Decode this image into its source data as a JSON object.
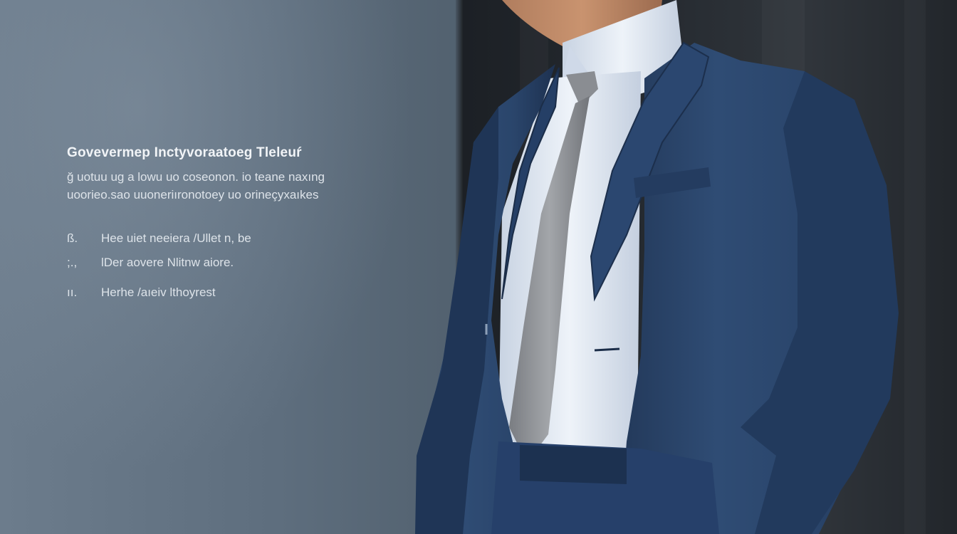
{
  "overlay": {
    "headline": "Govevermep Inctyvoraatoeg Tleleuŕ",
    "sub_lines": [
      "ğ uotuu ug a lowu  uo  coseonon.  io  teane  naxıng",
      "uoorieo.sao  uuoneriıronotoey  uo  orineçyxaıkes"
    ],
    "list_items": [
      {
        "num": "ß.",
        "text": "Hee  uiet  neeiera  /Ullet  n,  be"
      },
      {
        "num": ";.,",
        "text": "lDer  aovere  Nlitnw  aiore."
      },
      {
        "num": "ıı.",
        "text": "Herhe  /aıeiv  lthoyrest"
      }
    ]
  },
  "colors": {
    "panel": "#627282",
    "wall": "#22262b",
    "suit": "#2e4a72",
    "shirt": "#d9e4f2",
    "tie": "#8f9296"
  }
}
